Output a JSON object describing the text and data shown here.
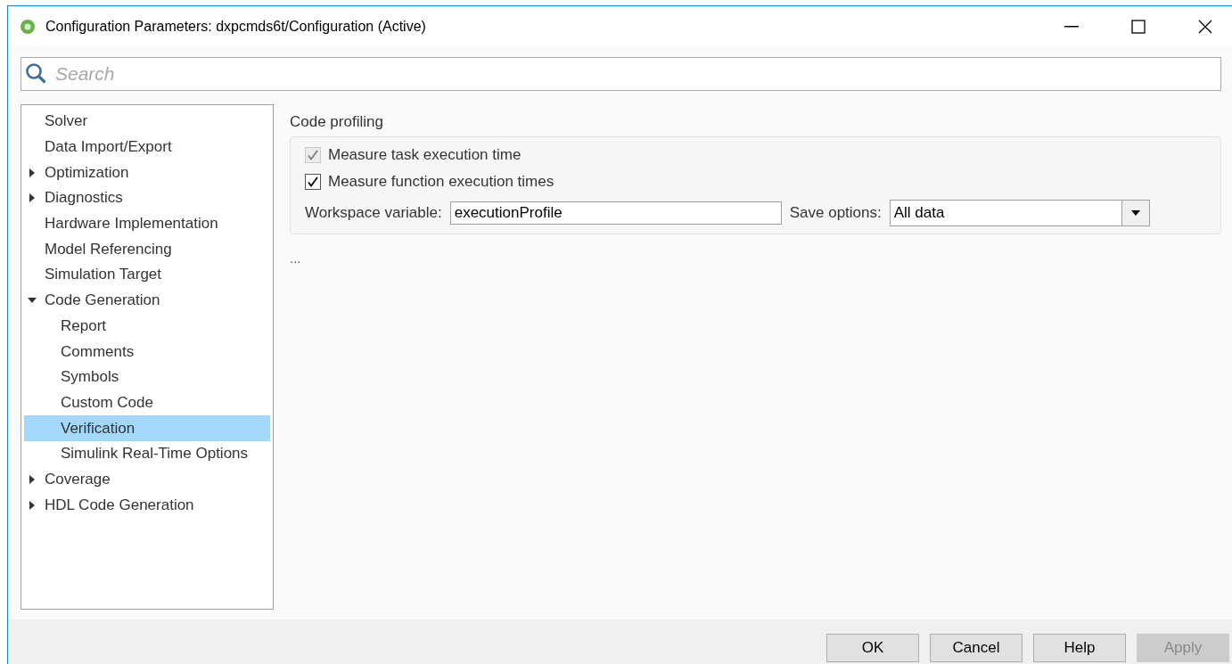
{
  "window": {
    "title": "Configuration Parameters: dxpcmds6t/Configuration (Active)"
  },
  "search": {
    "placeholder": "Search"
  },
  "tree": [
    {
      "label": "Solver",
      "selected": false
    },
    {
      "label": "Data Import/Export",
      "selected": false
    },
    {
      "label": "Optimization",
      "selected": false,
      "expanded": false
    },
    {
      "label": "Diagnostics",
      "selected": false,
      "expanded": false
    },
    {
      "label": "Hardware Implementation",
      "selected": false
    },
    {
      "label": "Model Referencing",
      "selected": false
    },
    {
      "label": "Simulation Target",
      "selected": false
    },
    {
      "label": "Code Generation",
      "selected": false,
      "expanded": true,
      "children": [
        {
          "label": "Report",
          "selected": false
        },
        {
          "label": "Comments",
          "selected": false
        },
        {
          "label": "Symbols",
          "selected": false
        },
        {
          "label": "Custom Code",
          "selected": false
        },
        {
          "label": "Verification",
          "selected": true
        },
        {
          "label": "Simulink Real-Time Options",
          "selected": false
        }
      ]
    },
    {
      "label": "Coverage",
      "selected": false,
      "expanded": false
    },
    {
      "label": "HDL Code Generation",
      "selected": false,
      "expanded": false
    }
  ],
  "section": {
    "title": "Code profiling",
    "checkboxes": [
      {
        "label": "Measure task execution time",
        "checked": true,
        "disabled": true
      },
      {
        "label": "Measure function execution times",
        "checked": true,
        "disabled": false
      }
    ],
    "workspace_variable": {
      "label": "Workspace variable:",
      "value": "executionProfile"
    },
    "save_options": {
      "label": "Save options:",
      "value": "All data"
    }
  },
  "more": "...",
  "buttons": [
    {
      "label": "OK",
      "disabled": false
    },
    {
      "label": "Cancel",
      "disabled": false
    },
    {
      "label": "Help",
      "disabled": false
    },
    {
      "label": "Apply",
      "disabled": true
    }
  ]
}
